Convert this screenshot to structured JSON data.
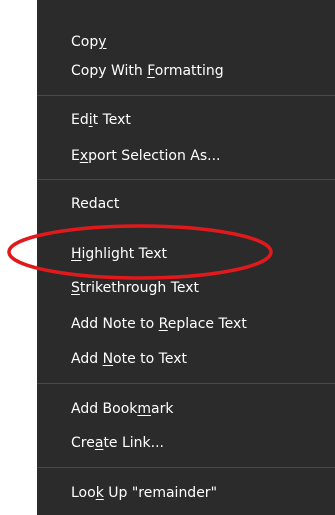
{
  "menu": {
    "items": [
      {
        "id": "copy",
        "pre": "Cop",
        "key": "y",
        "post": ""
      },
      {
        "id": "copy-with-formatting",
        "pre": "Copy With ",
        "key": "F",
        "post": "ormatting"
      },
      {
        "id": "edit-text",
        "pre": "Ed",
        "key": "i",
        "post": "t Text"
      },
      {
        "id": "export-selection-as",
        "pre": "E",
        "key": "x",
        "post": "port Selection As..."
      },
      {
        "id": "redact",
        "pre": "Redact",
        "key": "",
        "post": ""
      },
      {
        "id": "highlight-text",
        "pre": "",
        "key": "H",
        "post": "ighlight Text"
      },
      {
        "id": "strikethrough-text",
        "pre": "",
        "key": "S",
        "post": "trikethrough Text"
      },
      {
        "id": "add-note-to-replace-text",
        "pre": "Add Note to ",
        "key": "R",
        "post": "eplace Text"
      },
      {
        "id": "add-note-to-text",
        "pre": "Add ",
        "key": "N",
        "post": "ote to Text"
      },
      {
        "id": "add-bookmark",
        "pre": "Add Book",
        "key": "m",
        "post": "ark"
      },
      {
        "id": "create-link",
        "pre": "Cre",
        "key": "a",
        "post": "te Link..."
      },
      {
        "id": "look-up",
        "pre": "Loo",
        "key": "k",
        "post": " Up \"remainder\""
      }
    ]
  },
  "annotation": {
    "oval_color": "#e0191c",
    "target": "highlight-text"
  }
}
